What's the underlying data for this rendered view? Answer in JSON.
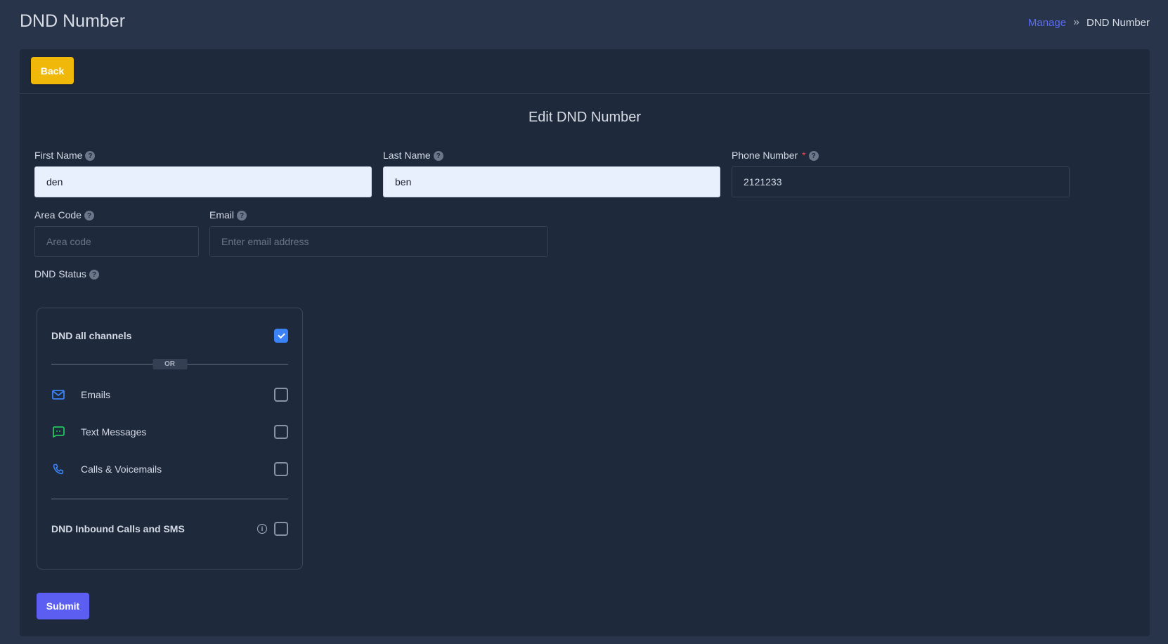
{
  "header": {
    "title": "DND Number",
    "breadcrumb": {
      "link": "Manage",
      "separator": "»",
      "current": "DND Number"
    }
  },
  "toolbar": {
    "back_label": "Back"
  },
  "form": {
    "title": "Edit DND Number",
    "first_name": {
      "label": "First Name",
      "value": "den"
    },
    "last_name": {
      "label": "Last Name",
      "value": "ben"
    },
    "phone_number": {
      "label": "Phone Number",
      "required_mark": "*",
      "value": "2121233"
    },
    "area_code": {
      "label": "Area Code",
      "value": "",
      "placeholder": "Area code"
    },
    "email": {
      "label": "Email",
      "value": "",
      "placeholder": "Enter email address"
    },
    "help_glyph": "?",
    "dnd_status": {
      "label": "DND Status",
      "all_channels": {
        "label": "DND all channels",
        "checked": true
      },
      "or_text": "OR",
      "channels": [
        {
          "label": "Emails",
          "icon": "mail-icon",
          "color": "#3b82f6",
          "checked": false
        },
        {
          "label": "Text Messages",
          "icon": "message-icon",
          "color": "#22c55e",
          "checked": false
        },
        {
          "label": "Calls & Voicemails",
          "icon": "phone-icon",
          "color": "#3b82f6",
          "checked": false
        }
      ],
      "inbound": {
        "label": "DND Inbound Calls and SMS",
        "info_glyph": "i",
        "checked": false
      }
    },
    "submit_label": "Submit"
  }
}
